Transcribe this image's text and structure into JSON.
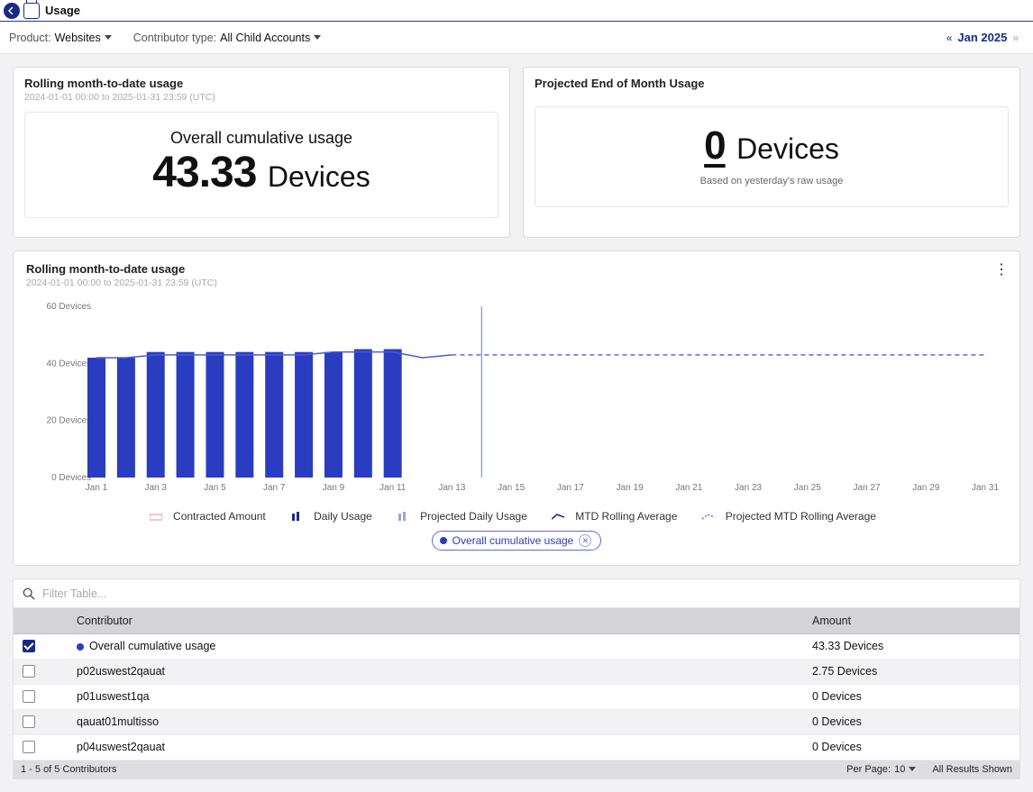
{
  "header": {
    "title": "Usage"
  },
  "filters": {
    "product_label": "Product:",
    "product_value": "Websites",
    "contrib_label": "Contributor type:",
    "contrib_value": "All Child Accounts",
    "period": "Jan 2025"
  },
  "card_mtd": {
    "title": "Rolling month-to-date usage",
    "range": "2024-01-01 00:00 to 2025-01-31 23:59 (UTC)",
    "label": "Overall cumulative usage",
    "value": "43.33",
    "unit": "Devices"
  },
  "card_proj": {
    "title": "Projected End of Month Usage",
    "value": "0",
    "unit": "Devices",
    "note": "Based on yesterday's raw usage"
  },
  "chart_card": {
    "title": "Rolling month-to-date usage",
    "range": "2024-01-01 00:00 to 2025-01-31 23:59 (UTC)"
  },
  "legend": {
    "contracted": "Contracted Amount",
    "daily": "Daily Usage",
    "projdaily": "Projected Daily Usage",
    "mtd": "MTD Rolling Average",
    "projmtd": "Projected MTD Rolling Average",
    "pill": "Overall cumulative usage"
  },
  "search_placeholder": "Filter Table...",
  "table": {
    "columns": [
      "Contributor",
      "Amount"
    ],
    "rows": [
      {
        "checked": true,
        "dot": true,
        "contributor": "Overall cumulative usage",
        "amount": "43.33 Devices"
      },
      {
        "checked": false,
        "dot": false,
        "contributor": "p02uswest2qauat",
        "amount": "2.75 Devices"
      },
      {
        "checked": false,
        "dot": false,
        "contributor": "p01uswest1qa",
        "amount": "0 Devices"
      },
      {
        "checked": false,
        "dot": false,
        "contributor": "qauat01multisso",
        "amount": "0 Devices"
      },
      {
        "checked": false,
        "dot": false,
        "contributor": "p04uswest2qauat",
        "amount": "0 Devices"
      }
    ]
  },
  "footer": {
    "range": "1 - 5 of 5 Contributors",
    "perpage_lbl": "Per Page:",
    "perpage_val": "10",
    "allshown": "All Results Shown"
  },
  "chart_data": {
    "type": "bar",
    "title": "Rolling month-to-date usage",
    "ylabel": "Devices",
    "ylim": [
      0,
      60
    ],
    "yticks": [
      "0 Devices",
      "20 Devices",
      "40 Devices",
      "60 Devices"
    ],
    "categories": [
      "Jan 1",
      "Jan 2",
      "Jan 3",
      "Jan 4",
      "Jan 5",
      "Jan 6",
      "Jan 7",
      "Jan 8",
      "Jan 9",
      "Jan 10",
      "Jan 11",
      "Jan 12",
      "Jan 13",
      "Jan 14",
      "Jan 15",
      "Jan 16",
      "Jan 17",
      "Jan 18",
      "Jan 19",
      "Jan 20",
      "Jan 21",
      "Jan 22",
      "Jan 23",
      "Jan 24",
      "Jan 25",
      "Jan 26",
      "Jan 27",
      "Jan 28",
      "Jan 29",
      "Jan 30",
      "Jan 31"
    ],
    "xtick_step": 2,
    "series": [
      {
        "name": "Daily Usage (bars)",
        "values": [
          42,
          42,
          44,
          44,
          44,
          44,
          44,
          44,
          44,
          45,
          45,
          null,
          null,
          null,
          null,
          null,
          null,
          null,
          null,
          null,
          null,
          null,
          null,
          null,
          null,
          null,
          null,
          null,
          null,
          null,
          null
        ]
      },
      {
        "name": "MTD Rolling Average (line)",
        "values": [
          42,
          42,
          43,
          43,
          43,
          43,
          43,
          43,
          44,
          44,
          44,
          42,
          43,
          null,
          null,
          null,
          null,
          null,
          null,
          null,
          null,
          null,
          null,
          null,
          null,
          null,
          null,
          null,
          null,
          null,
          null
        ]
      },
      {
        "name": "Projected MTD (dashed)",
        "values": [
          null,
          null,
          null,
          null,
          null,
          null,
          null,
          null,
          null,
          null,
          null,
          null,
          43,
          43,
          43,
          43,
          43,
          43,
          43,
          43,
          43,
          43,
          43,
          43,
          43,
          43,
          43,
          43,
          43,
          43,
          43
        ]
      }
    ],
    "today_index": 13
  }
}
